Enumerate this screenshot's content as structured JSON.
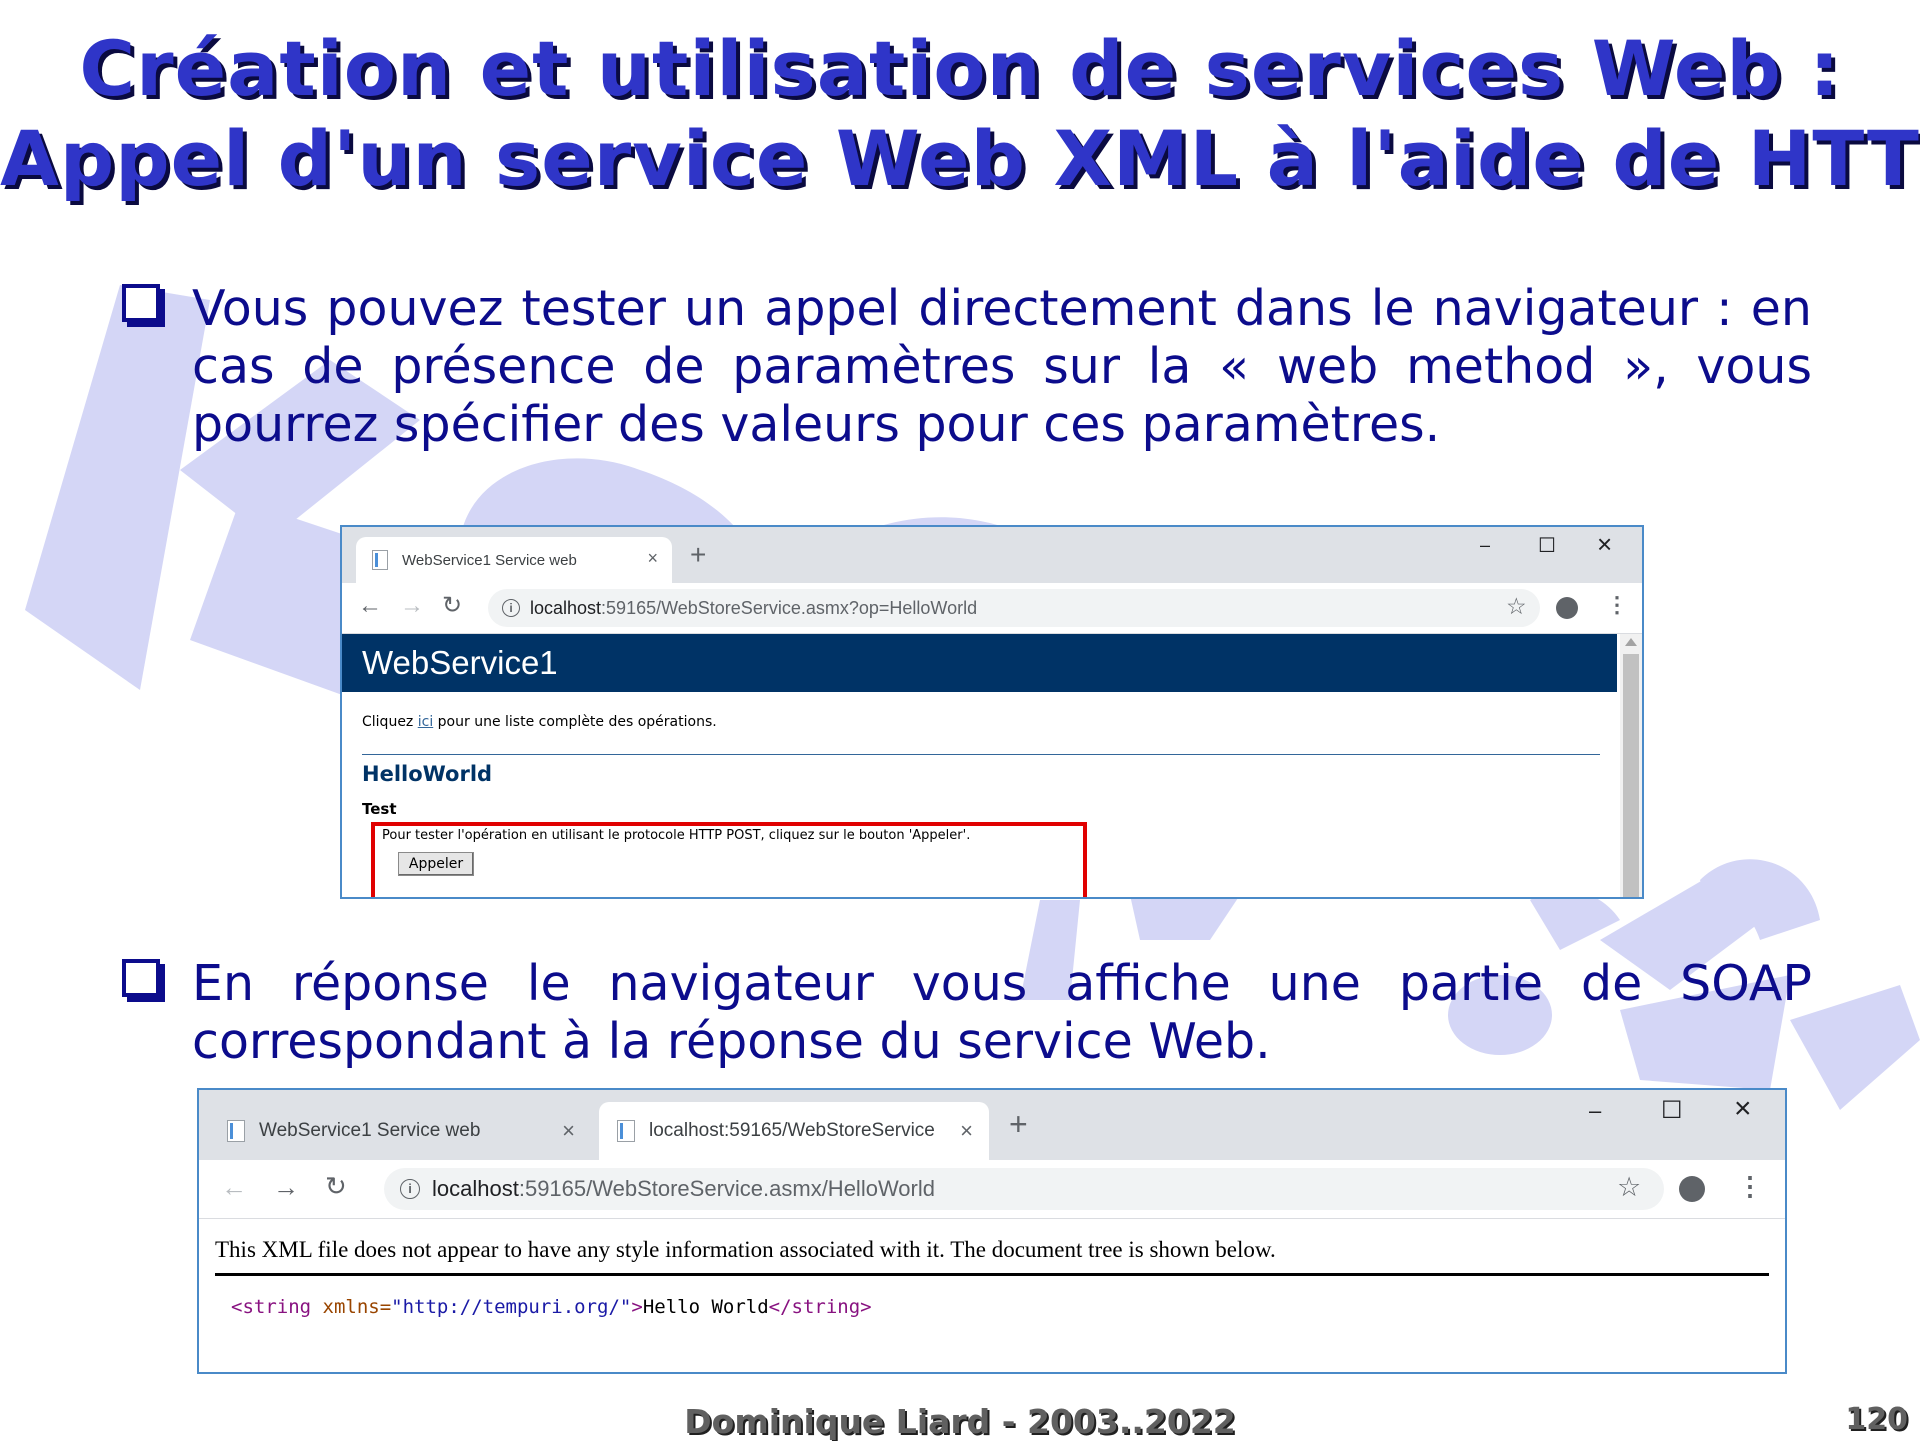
{
  "slide": {
    "title_line1": "Création et utilisation de services Web :",
    "title_line2": "Appel d'un service Web XML à l'aide de HTTP",
    "bullet1": "Vous pouvez tester un appel directement dans le navigateur : en cas de présence de paramètres sur la « web method », vous pourrez spécifier des valeurs pour ces paramètres.",
    "bullet2": "En réponse le navigateur vous affiche une partie de SOAP correspondant à la réponse du service Web.",
    "footer": "Dominique Liard - 2003..2022",
    "page_number": "120",
    "watermark_text": "koor.fr"
  },
  "browser1": {
    "tab_title": "WebService1 Service web",
    "url_host": "localhost",
    "url_rest": ":59165/WebStoreService.asmx?op=HelloWorld",
    "service_name": "WebService1",
    "intro_before": "Cliquez ",
    "intro_link": "ici",
    "intro_after": " pour une liste complète des opérations.",
    "operation": "HelloWorld",
    "test_heading": "Test",
    "test_text": "Pour tester l'opération en utilisant le protocole HTTP POST, cliquez sur le bouton 'Appeler'.",
    "invoke_button": "Appeler"
  },
  "browser2": {
    "tab1_title": "WebService1 Service web",
    "tab2_title": "localhost:59165/WebStoreService",
    "url_host": "localhost",
    "url_rest": ":59165/WebStoreService.asmx/HelloWorld",
    "note": "This XML file does not appear to have any style information associated with it. The document tree is shown below.",
    "xml_open": "<string",
    "xml_attr_name": " xmlns=",
    "xml_attr_value": "\"http://tempuri.org/\"",
    "xml_open_end": ">",
    "xml_text": "Hello World",
    "xml_close": "</string>"
  },
  "icons": {
    "close": "×",
    "new_tab": "+",
    "minimize": "–",
    "maximize": "☐",
    "back": "←",
    "forward": "→",
    "reload": "↻",
    "star": "☆",
    "menu": "⋮",
    "info": "i"
  },
  "colors": {
    "title": "#2f35c8",
    "bullet_text": "#0c0c8c",
    "watermark": "#d4d6f6",
    "service_header": "#003366",
    "highlight": "#e00000"
  }
}
